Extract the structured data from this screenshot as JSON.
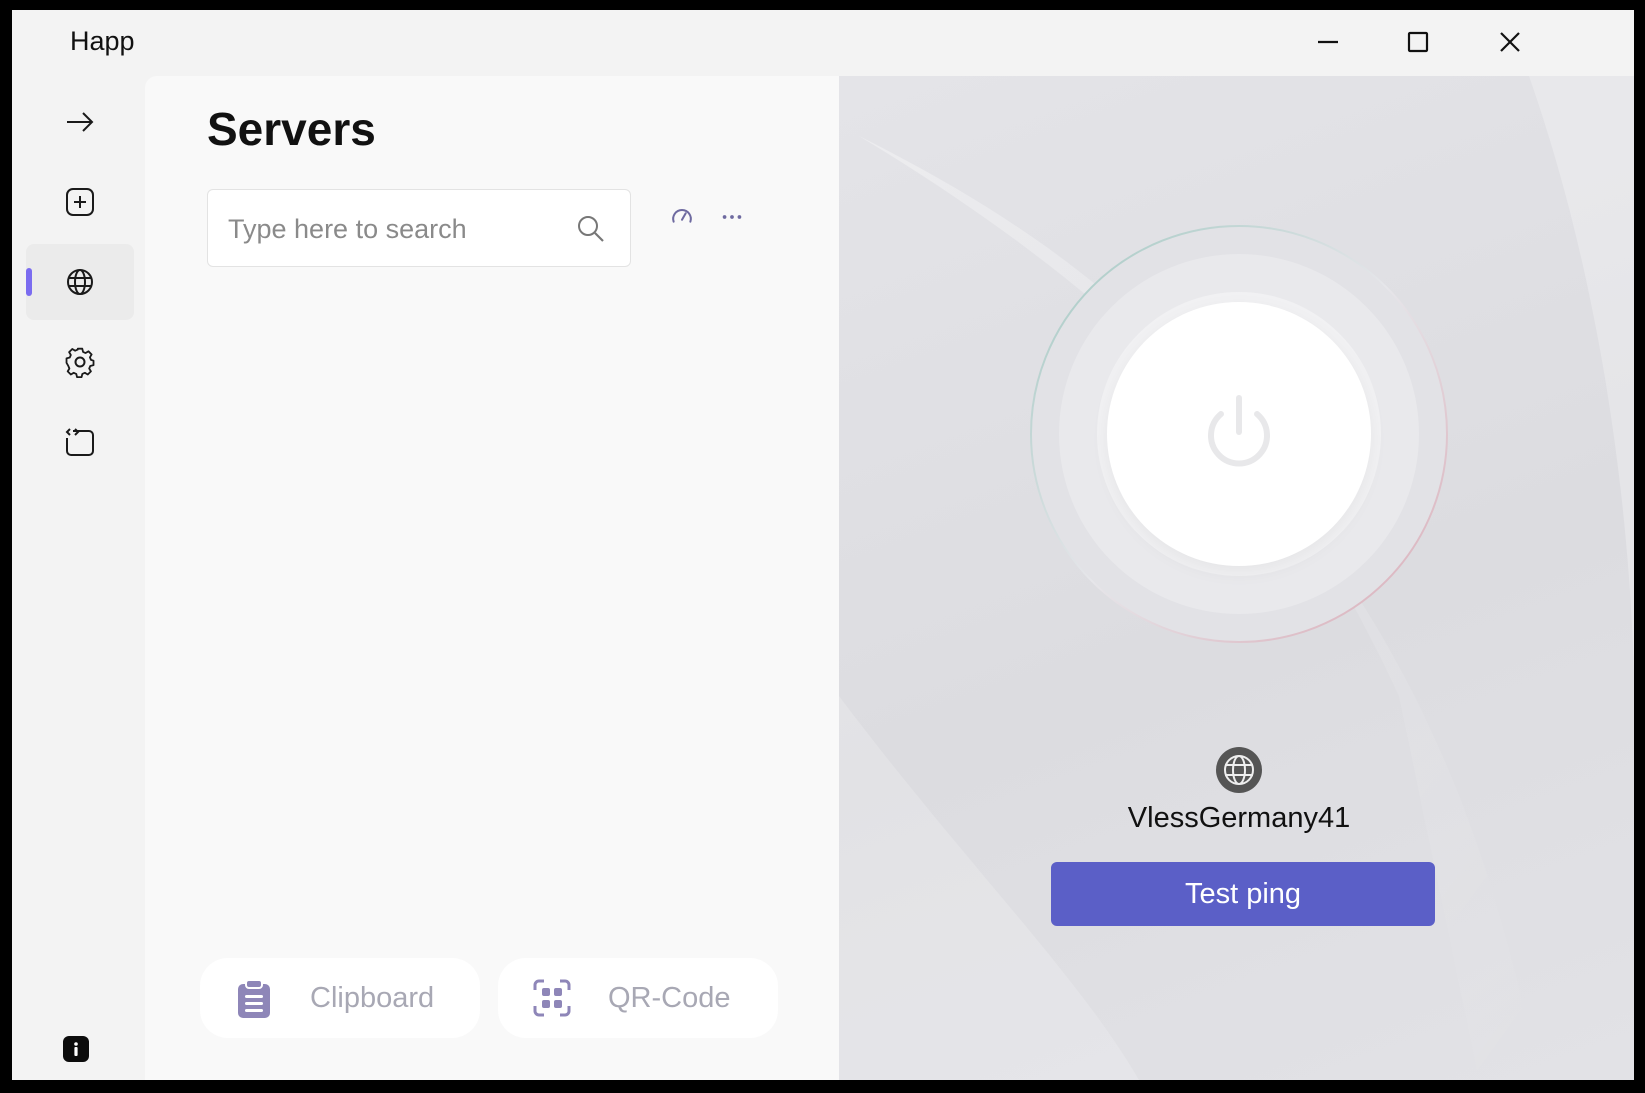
{
  "app": {
    "title": "Happ",
    "accent_color": "#5b5fc7",
    "nav_indicator_color": "#7b6cf0"
  },
  "window_controls": [
    {
      "name": "minimize",
      "icon": "minimize-icon"
    },
    {
      "name": "maximize",
      "icon": "maximize-icon"
    },
    {
      "name": "close",
      "icon": "close-icon"
    }
  ],
  "sidebar": {
    "items": [
      {
        "id": "connect",
        "icon": "arrow-right-icon",
        "active": false
      },
      {
        "id": "add",
        "icon": "add-square-icon",
        "active": false
      },
      {
        "id": "servers",
        "icon": "globe-icon",
        "active": true
      },
      {
        "id": "settings",
        "icon": "gear-icon",
        "active": false
      },
      {
        "id": "logs",
        "icon": "code-window-icon",
        "active": false
      }
    ],
    "footer_icon": "info-icon"
  },
  "servers_page": {
    "title": "Servers",
    "search": {
      "placeholder": "Type here to search",
      "value": ""
    },
    "toolbar": {
      "ping_all_icon": "speedometer-icon",
      "more_icon": "more-horizontal-icon"
    },
    "import_buttons": [
      {
        "label": "Clipboard",
        "icon": "clipboard-icon"
      },
      {
        "label": "QR-Code",
        "icon": "qr-code-icon"
      }
    ]
  },
  "connection": {
    "power_icon": "power-icon",
    "server_icon": "globe-icon",
    "server_name": "VlessGermany41",
    "test_ping_label": "Test ping"
  }
}
